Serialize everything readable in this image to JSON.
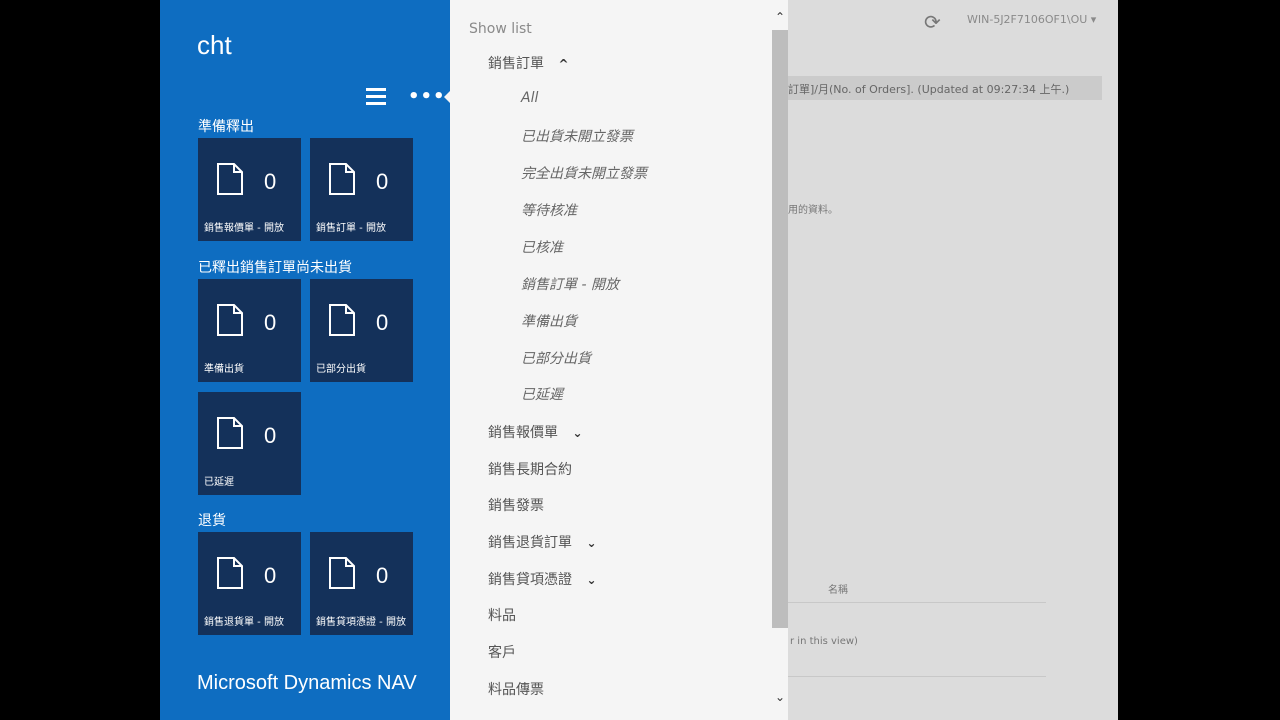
{
  "nav": {
    "company": "cht",
    "brand": "Microsoft Dynamics NAV",
    "groups": [
      {
        "title": "準備釋出",
        "tiles": [
          {
            "count": "0",
            "label": "銷售報價單 - 開放"
          },
          {
            "count": "0",
            "label": "銷售訂單 - 開放"
          }
        ]
      },
      {
        "title": "已釋出銷售訂單尚未出貨",
        "tiles": [
          {
            "count": "0",
            "label": "準備出貨"
          },
          {
            "count": "0",
            "label": "已部分出貨"
          },
          {
            "count": "0",
            "label": "已延遲"
          }
        ]
      },
      {
        "title": "退貨",
        "tiles": [
          {
            "count": "0",
            "label": "銷售退貨單 - 開放"
          },
          {
            "count": "0",
            "label": "銷售貸項憑證 - 開放"
          }
        ]
      }
    ]
  },
  "dropdown": {
    "header": "Show list",
    "sales_orders": {
      "label": "銷售訂單",
      "chevron": "^"
    },
    "sub_items": [
      "All",
      "已出貨未開立發票",
      "完全出貨未開立發票",
      "等待核准",
      "已核准",
      "銷售訂單 - 開放",
      "準備出貨",
      "已部分出貨",
      "已延遲"
    ],
    "items": [
      {
        "label": "銷售報價單",
        "chevron": "⌄"
      },
      {
        "label": "銷售長期合約",
        "chevron": ""
      },
      {
        "label": "銷售發票",
        "chevron": ""
      },
      {
        "label": "銷售退貨訂單",
        "chevron": "⌄"
      },
      {
        "label": "銷售貸項憑證",
        "chevron": "⌄"
      },
      {
        "label": "料品",
        "chevron": ""
      },
      {
        "label": "客戶",
        "chevron": ""
      },
      {
        "label": "料品傳票",
        "chevron": ""
      }
    ],
    "scroll_up": "⌃",
    "scroll_down": "⌄"
  },
  "background": {
    "refresh_icon": "⟳",
    "user": "WIN-5J2F7106OF1\\OU ▾",
    "banner": "訂單]/月(No. of Orders]. (Updated at 09:27:34 上午.)",
    "note": "用的資料。",
    "col_header": "名稱",
    "empty_msg": "r in this view)"
  }
}
